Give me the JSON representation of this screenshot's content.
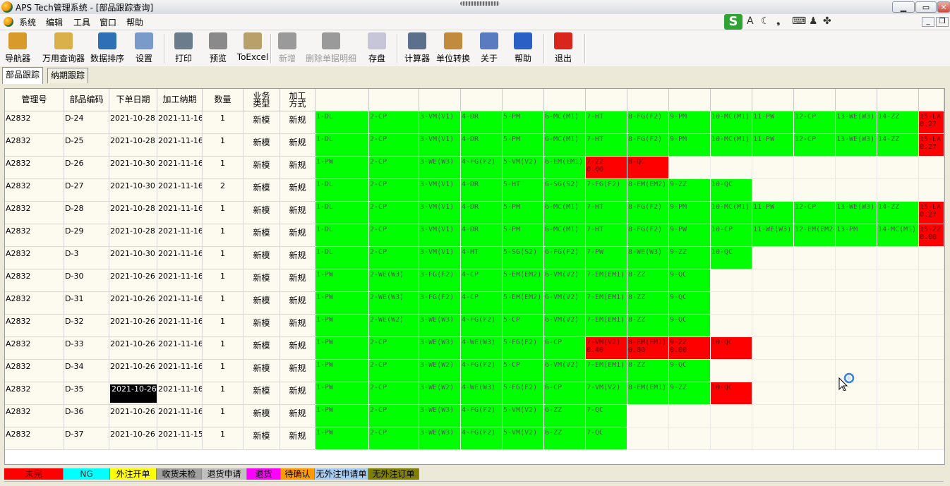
{
  "window": {
    "title": "APS Tech管理系统 - [部品跟踪查询]",
    "min": "▁",
    "max": "▭",
    "close": "✕"
  },
  "menu": [
    "系统",
    "编辑",
    "工具",
    "窗口",
    "帮助"
  ],
  "ime": {
    "logo": "S",
    "glyphs": [
      "A",
      "☾",
      "❟",
      "⌨",
      "♟",
      "✤"
    ]
  },
  "mdi": {
    "min": "_",
    "restore": "❐"
  },
  "toolbar": [
    {
      "label": "导航器",
      "icon": "house-icon",
      "color": "#d89a2a",
      "enabled": true
    },
    {
      "label": "万用查询器",
      "icon": "search-tool-icon",
      "color": "#d9b04a",
      "enabled": true
    },
    {
      "label": "数据排序",
      "icon": "sort-icon",
      "color": "#2f6fb5",
      "enabled": true
    },
    {
      "label": "设置",
      "icon": "settings-icon",
      "color": "#7a9acb",
      "enabled": true
    },
    {
      "label": "打印",
      "icon": "printer-icon",
      "color": "#6b7c8a",
      "enabled": true
    },
    {
      "label": "预览",
      "icon": "preview-icon",
      "color": "#8a8a8a",
      "enabled": true
    },
    {
      "label": "ToExcel",
      "icon": "excel-icon",
      "color": "#b8a06b",
      "enabled": true
    },
    {
      "label": "新增",
      "icon": "add-icon",
      "color": "#9a9a9a",
      "enabled": false
    },
    {
      "label": "删除单据明细",
      "icon": "delete-detail-icon",
      "color": "#9a9a9a",
      "enabled": false
    },
    {
      "label": "存盘",
      "icon": "save-icon",
      "color": "#c6c6d8",
      "enabled": true
    },
    {
      "label": "计算器",
      "icon": "calculator-icon",
      "color": "#5c6f8c",
      "enabled": true
    },
    {
      "label": "单位转换",
      "icon": "unit-convert-icon",
      "color": "#c28a3c",
      "enabled": true
    },
    {
      "label": "关于",
      "icon": "about-icon",
      "color": "#5a7bbf",
      "enabled": true
    },
    {
      "label": "帮助",
      "icon": "help-icon",
      "color": "#2a5fc6",
      "enabled": true
    },
    {
      "label": "退出",
      "icon": "exit-icon",
      "color": "#d8261c",
      "enabled": true
    }
  ],
  "tabs": [
    {
      "label": "部品跟踪",
      "active": true
    },
    {
      "label": "纳期跟踪",
      "active": false
    }
  ],
  "headers": [
    "管理号",
    "部品编码",
    "下单日期",
    "加工纳期",
    "数量",
    "业务类型",
    "加工方式"
  ],
  "rows": [
    {
      "mgmt": "A2832",
      "code": "D-24",
      "order": "2021-10-28",
      "due": "2021-11-16",
      "qty": "1",
      "biz": "新模",
      "proc": "新规",
      "steps": [
        [
          "1-DL",
          "g"
        ],
        [
          "2-CP",
          "g"
        ],
        [
          "3-VM(V1)",
          "g"
        ],
        [
          "4-DR",
          "g"
        ],
        [
          "5-PM",
          "g"
        ],
        [
          "6-MC(M1)",
          "g"
        ],
        [
          "7-HT",
          "g"
        ],
        [
          "8-FG(F2)",
          "g"
        ],
        [
          "9-PM",
          "g"
        ],
        [
          "10-MC(M1)",
          "g"
        ],
        [
          "11-PW",
          "g"
        ],
        [
          "12-CP",
          "g"
        ],
        [
          "13-WE(W3)",
          "g"
        ],
        [
          "14-ZZ",
          "g"
        ],
        [
          "15-LA\n0.27",
          "r"
        ]
      ]
    },
    {
      "mgmt": "A2832",
      "code": "D-25",
      "order": "2021-10-28",
      "due": "2021-11-16",
      "qty": "1",
      "biz": "新模",
      "proc": "新规",
      "steps": [
        [
          "1-DL",
          "g"
        ],
        [
          "2-CP",
          "g"
        ],
        [
          "3-VM(V1)",
          "g"
        ],
        [
          "4-DR",
          "g"
        ],
        [
          "5-PM",
          "g"
        ],
        [
          "6-MC(M1)",
          "g"
        ],
        [
          "7-HT",
          "g"
        ],
        [
          "8-FG(F2)",
          "g"
        ],
        [
          "9-PM",
          "g"
        ],
        [
          "10-MC(M1)",
          "g"
        ],
        [
          "11-PW",
          "g"
        ],
        [
          "12-CP",
          "g"
        ],
        [
          "13-WE(W3)",
          "g"
        ],
        [
          "14-ZZ",
          "g"
        ],
        [
          "15-LA\n0.27",
          "r"
        ]
      ]
    },
    {
      "mgmt": "A2832",
      "code": "D-26",
      "order": "2021-10-30",
      "due": "2021-11-16",
      "qty": "1",
      "biz": "新模",
      "proc": "新规",
      "steps": [
        [
          "1-PW",
          "g"
        ],
        [
          "2-CP",
          "g"
        ],
        [
          "3-WE(W3)",
          "g"
        ],
        [
          "4-FG(F2)",
          "g"
        ],
        [
          "5-VM(V2)",
          "g"
        ],
        [
          "6-EM(EM1)",
          "g"
        ],
        [
          "7-ZZ\n0.00",
          "r"
        ],
        [
          "8-QC",
          "r"
        ]
      ]
    },
    {
      "mgmt": "A2832",
      "code": "D-27",
      "order": "2021-10-30",
      "due": "2021-11-16",
      "qty": "2",
      "biz": "新模",
      "proc": "新规",
      "steps": [
        [
          "1-DL",
          "g"
        ],
        [
          "2-CP",
          "g"
        ],
        [
          "3-VM(V1)",
          "g"
        ],
        [
          "4-DR",
          "g"
        ],
        [
          "5-HT",
          "g"
        ],
        [
          "6-SG(S2)",
          "g"
        ],
        [
          "7-FG(F2)",
          "g"
        ],
        [
          "8-EM(EM2)",
          "g"
        ],
        [
          "9-ZZ",
          "g"
        ],
        [
          "10-QC",
          "g"
        ]
      ]
    },
    {
      "mgmt": "A2832",
      "code": "D-28",
      "order": "2021-10-28",
      "due": "2021-11-16",
      "qty": "1",
      "biz": "新模",
      "proc": "新规",
      "steps": [
        [
          "1-DL",
          "g"
        ],
        [
          "2-CP",
          "g"
        ],
        [
          "3-VM(V1)",
          "g"
        ],
        [
          "4-DR",
          "g"
        ],
        [
          "5-PM",
          "g"
        ],
        [
          "6-MC(M1)",
          "g"
        ],
        [
          "7-HT",
          "g"
        ],
        [
          "8-FG(F2)",
          "g"
        ],
        [
          "9-PM",
          "g"
        ],
        [
          "10-MC(M1)",
          "g"
        ],
        [
          "11-PW",
          "g"
        ],
        [
          "12-CP",
          "g"
        ],
        [
          "13-WE(W3)",
          "g"
        ],
        [
          "14-ZZ",
          "g"
        ],
        [
          "15-LA\n0.27",
          "r"
        ]
      ]
    },
    {
      "mgmt": "A2832",
      "code": "D-29",
      "order": "2021-10-28",
      "due": "2021-11-16",
      "qty": "1",
      "biz": "新模",
      "proc": "新规",
      "steps": [
        [
          "1-DL",
          "g"
        ],
        [
          "2-CP",
          "g"
        ],
        [
          "3-VM(V1)",
          "g"
        ],
        [
          "4-DR",
          "g"
        ],
        [
          "5-PM",
          "g"
        ],
        [
          "6-MC(M1)",
          "g"
        ],
        [
          "7-HT",
          "g"
        ],
        [
          "8-FG(F2)",
          "g"
        ],
        [
          "9-PW",
          "g"
        ],
        [
          "10-CP",
          "g"
        ],
        [
          "11-WE(W3)",
          "g"
        ],
        [
          "12-EM(EM2",
          "g"
        ],
        [
          "13-PM",
          "g"
        ],
        [
          "14-MC(M1)",
          "g"
        ],
        [
          "15-ZZ\n0.00",
          "r"
        ]
      ]
    },
    {
      "mgmt": "A2832",
      "code": "D-3",
      "order": "2021-10-30",
      "due": "2021-11-16",
      "qty": "1",
      "biz": "新模",
      "proc": "新规",
      "steps": [
        [
          "1-DL",
          "g"
        ],
        [
          "2-CP",
          "g"
        ],
        [
          "3-VM(V1)",
          "g"
        ],
        [
          "4-HT",
          "g"
        ],
        [
          "5-SG(S2)",
          "g"
        ],
        [
          "6-FG(F2)",
          "g"
        ],
        [
          "7-PW",
          "g"
        ],
        [
          "8-WE(W3)",
          "g"
        ],
        [
          "9-ZZ",
          "g"
        ],
        [
          "10-QC",
          "g"
        ]
      ]
    },
    {
      "mgmt": "A2832",
      "code": "D-30",
      "order": "2021-10-26",
      "due": "2021-11-16",
      "qty": "1",
      "biz": "新模",
      "proc": "新规",
      "steps": [
        [
          "1-PW",
          "g"
        ],
        [
          "2-WE(W3)",
          "g"
        ],
        [
          "3-FG(F2)",
          "g"
        ],
        [
          "4-CP",
          "g"
        ],
        [
          "5-EM(EM2)",
          "g"
        ],
        [
          "6-VM(V2)",
          "g"
        ],
        [
          "7-EM(EM1)",
          "g"
        ],
        [
          "8-ZZ",
          "g"
        ],
        [
          "9-QC",
          "g"
        ]
      ]
    },
    {
      "mgmt": "A2832",
      "code": "D-31",
      "order": "2021-10-26",
      "due": "2021-11-16",
      "qty": "1",
      "biz": "新模",
      "proc": "新规",
      "steps": [
        [
          "1-PW",
          "g"
        ],
        [
          "2-WE(W3)",
          "g"
        ],
        [
          "3-FG(F2)",
          "g"
        ],
        [
          "4-CP",
          "g"
        ],
        [
          "5-EM(EM2)",
          "g"
        ],
        [
          "6-VM(V2)",
          "g"
        ],
        [
          "7-EM(EM1)",
          "g"
        ],
        [
          "8-ZZ",
          "g"
        ],
        [
          "9-QC",
          "g"
        ]
      ]
    },
    {
      "mgmt": "A2832",
      "code": "D-32",
      "order": "2021-10-26",
      "due": "2021-11-16",
      "qty": "1",
      "biz": "新模",
      "proc": "新规",
      "steps": [
        [
          "1-PW",
          "g"
        ],
        [
          "2-WE(W2)",
          "g"
        ],
        [
          "3-WE(W3)",
          "g"
        ],
        [
          "4-FG(F2)",
          "g"
        ],
        [
          "5-CP",
          "g"
        ],
        [
          "6-VM(V2)",
          "g"
        ],
        [
          "7-EM(EM1)",
          "g"
        ],
        [
          "8-ZZ",
          "g"
        ],
        [
          "9-QC",
          "g"
        ]
      ]
    },
    {
      "mgmt": "A2832",
      "code": "D-33",
      "order": "2021-10-26",
      "due": "2021-11-16",
      "qty": "1",
      "biz": "新模",
      "proc": "新规",
      "steps": [
        [
          "1-PW",
          "g"
        ],
        [
          "2-CP",
          "g"
        ],
        [
          "3-WE(W3)",
          "g"
        ],
        [
          "4-WE(W3)",
          "g"
        ],
        [
          "5-FG(F2)",
          "g"
        ],
        [
          "6-CP",
          "g"
        ],
        [
          "7-VM(V2)\n0.40",
          "r"
        ],
        [
          "8-EM(EM1)\n0.80",
          "r"
        ],
        [
          "9-ZZ\n0.00",
          "r"
        ],
        [
          "10-QC",
          "r"
        ]
      ]
    },
    {
      "mgmt": "A2832",
      "code": "D-34",
      "order": "2021-10-26",
      "due": "2021-11-16",
      "qty": "1",
      "biz": "新模",
      "proc": "新规",
      "steps": [
        [
          "1-PW",
          "g"
        ],
        [
          "2-CP",
          "g"
        ],
        [
          "3-WE(W2)",
          "g"
        ],
        [
          "4-FG(F2)",
          "g"
        ],
        [
          "5-CP",
          "g"
        ],
        [
          "6-VM(V2)",
          "g"
        ],
        [
          "7-EM(EM1)",
          "g"
        ],
        [
          "8-ZZ",
          "g"
        ],
        [
          "9-QC",
          "g"
        ]
      ]
    },
    {
      "mgmt": "A2832",
      "code": "D-35",
      "order": "2021-10-26",
      "due": "2021-11-16",
      "qty": "1",
      "biz": "新模",
      "proc": "新规",
      "selected": true,
      "steps": [
        [
          "1-PW",
          "g"
        ],
        [
          "2-CP",
          "g"
        ],
        [
          "3-WE(W2)",
          "g"
        ],
        [
          "4-WE(W3)",
          "g"
        ],
        [
          "5-FG(F2)",
          "g"
        ],
        [
          "6-CP",
          "g"
        ],
        [
          "7-VM(V2)",
          "g"
        ],
        [
          "8-EM(EM1)",
          "g"
        ],
        [
          "9-ZZ",
          "g"
        ],
        [
          "10-QC",
          "r"
        ]
      ]
    },
    {
      "mgmt": "A2832",
      "code": "D-36",
      "order": "2021-10-26",
      "due": "2021-11-16",
      "qty": "1",
      "biz": "新模",
      "proc": "新规",
      "steps": [
        [
          "1-PW",
          "g"
        ],
        [
          "2-CP",
          "g"
        ],
        [
          "3-WE(W3)",
          "g"
        ],
        [
          "4-FG(F2)",
          "g"
        ],
        [
          "5-VM(V2)",
          "g"
        ],
        [
          "6-ZZ",
          "g"
        ],
        [
          "7-QC",
          "g"
        ]
      ]
    },
    {
      "mgmt": "A2832",
      "code": "D-37",
      "order": "2021-10-26",
      "due": "2021-11-15",
      "qty": "1",
      "biz": "新模",
      "proc": "新规",
      "steps": [
        [
          "1-PW",
          "g"
        ],
        [
          "2-CP",
          "g"
        ],
        [
          "3-WE(W3)",
          "g"
        ],
        [
          "4-FG(F2)",
          "g"
        ],
        [
          "5-VM(V2)",
          "g"
        ],
        [
          "6-ZZ",
          "g"
        ],
        [
          "7-QC",
          "g"
        ]
      ]
    }
  ],
  "legend": [
    {
      "label": "未完",
      "color": "#ff0000",
      "text": "#5a0000"
    },
    {
      "label": "NG",
      "color": "#00ffff",
      "text": "#333333"
    },
    {
      "label": "外注开单",
      "color": "#ffff00",
      "text": "#000000"
    },
    {
      "label": "收货未检",
      "color": "#a0a0a0",
      "text": "#000000"
    },
    {
      "label": "退货申请",
      "color": "#c0c0c0",
      "text": "#000000"
    },
    {
      "label": "退货",
      "color": "#ff00ff",
      "text": "#000000"
    },
    {
      "label": "待确认",
      "color": "#ff9900",
      "text": "#000000"
    },
    {
      "label": "无外注申请单",
      "color": "#a6caf0",
      "text": "#000000"
    },
    {
      "label": "无外注订单",
      "color": "#808000",
      "text": "#000000"
    }
  ],
  "colors": {
    "done": "#00ff00",
    "pending": "#ff0000"
  }
}
